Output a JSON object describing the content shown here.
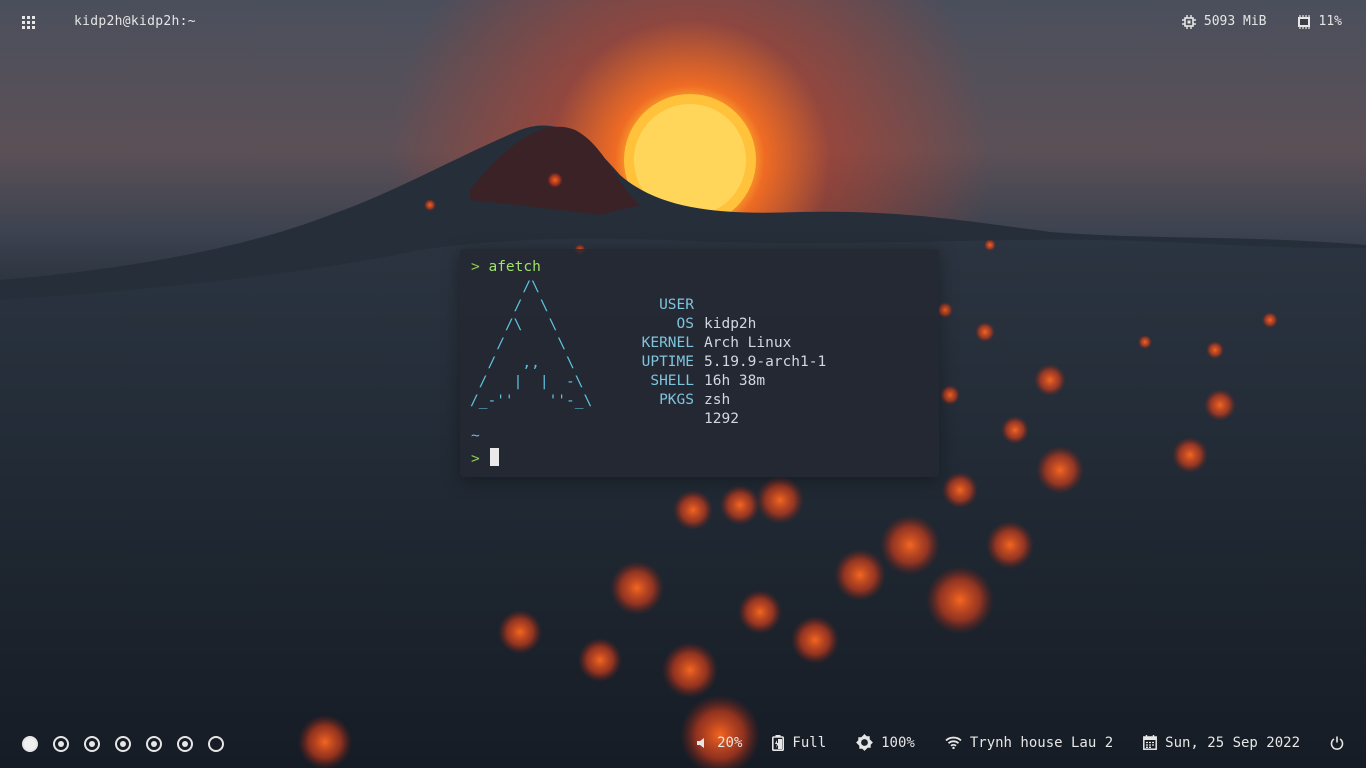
{
  "topbar": {
    "window_title": "kidp2h@kidp2h:~",
    "memory": "5093 MiB",
    "cpu": "11%"
  },
  "terminal": {
    "prompt_symbol": ">",
    "command": "afetch",
    "ascii_art": "      /\\\n     /  \\\n    /\\   \\\n   /      \\\n  /   ,,   \\\n /   |  |  -\\\n/_-''    ''-_\\",
    "info": [
      {
        "key": "USER",
        "value": "kidp2h"
      },
      {
        "key": "OS",
        "value": "Arch Linux"
      },
      {
        "key": "KERNEL",
        "value": "5.19.9-arch1-1"
      },
      {
        "key": "UPTIME",
        "value": "16h 38m"
      },
      {
        "key": "SHELL",
        "value": "zsh"
      },
      {
        "key": "PKGS",
        "value": "1292"
      }
    ],
    "cwd": "~",
    "prompt_symbol_2": ">"
  },
  "bottombar": {
    "workspaces": [
      "active",
      "occupied",
      "occupied",
      "occupied",
      "occupied",
      "occupied",
      "empty"
    ],
    "volume": "20%",
    "battery": "Full",
    "brightness": "100%",
    "wifi": "Trynh house Lau 2",
    "date": "Sun, 25 Sep 2022"
  },
  "icons": [
    "apps-grid-icon",
    "memory-chip-icon",
    "cpu-icon",
    "volume-icon",
    "battery-icon",
    "brightness-icon",
    "wifi-icon",
    "calendar-icon",
    "power-icon"
  ],
  "colors": {
    "accent_green": "#8fcf4a",
    "accent_cyan": "#5fc3e0",
    "terminal_bg": "#242832"
  }
}
